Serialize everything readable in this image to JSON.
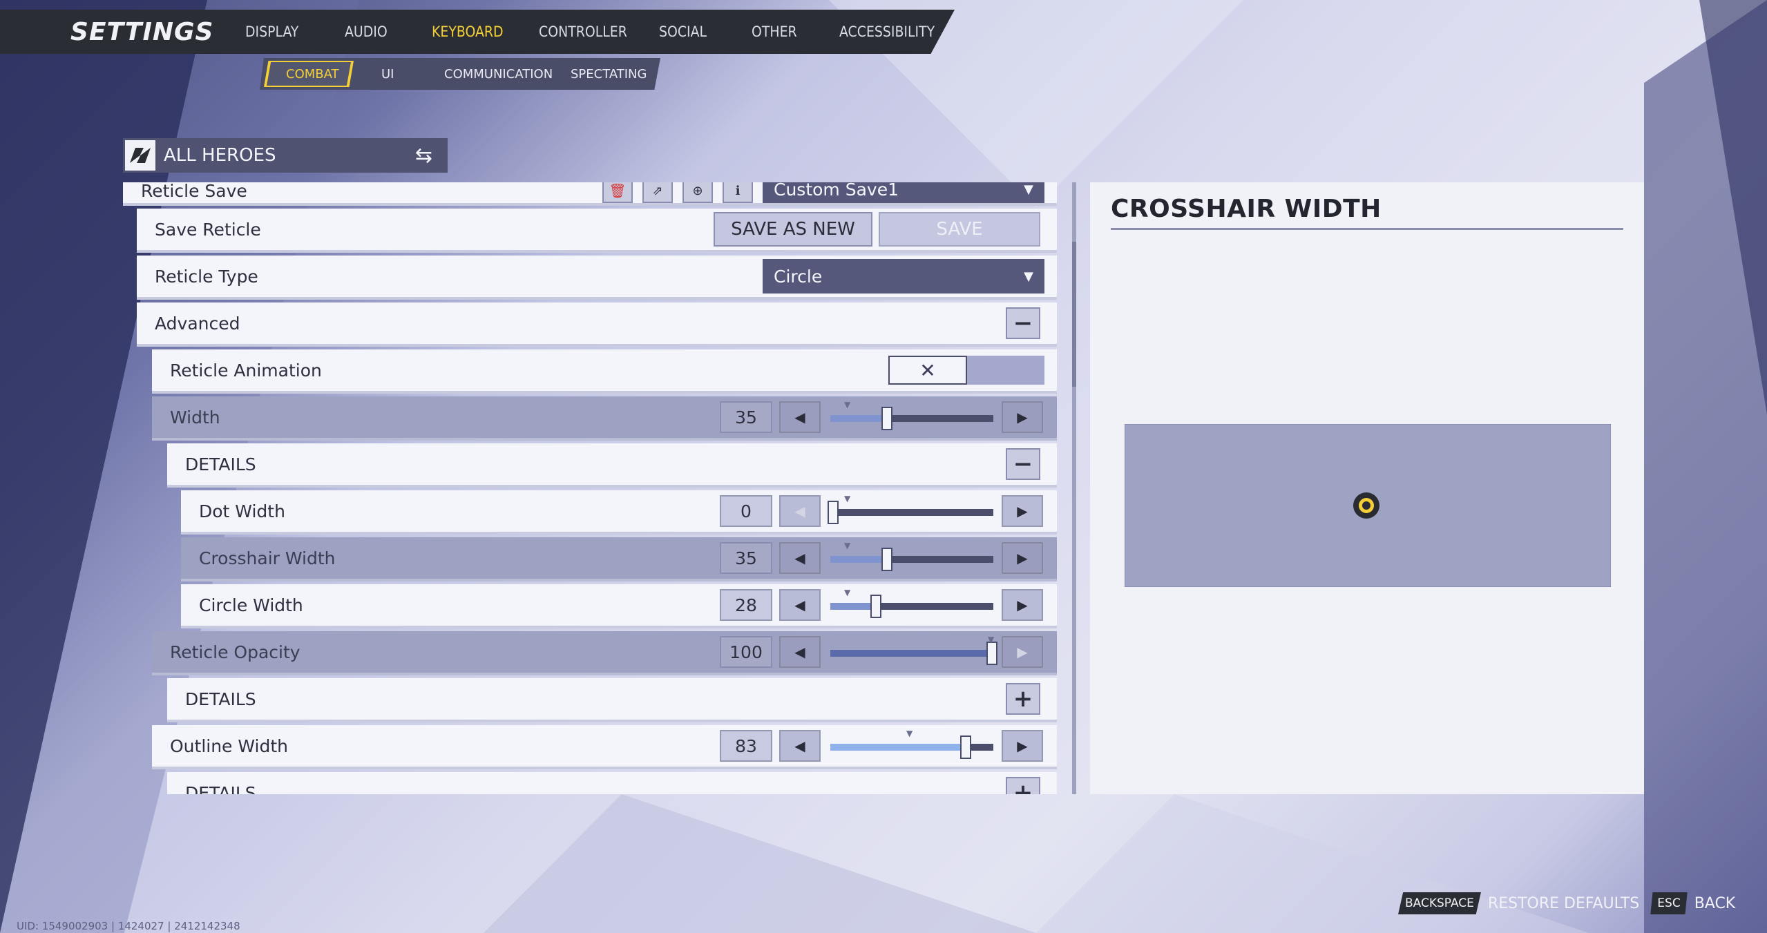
{
  "header": {
    "title": "SETTINGS",
    "tabs": [
      {
        "label": "DISPLAY",
        "active": false
      },
      {
        "label": "AUDIO",
        "active": false
      },
      {
        "label": "KEYBOARD",
        "active": true
      },
      {
        "label": "CONTROLLER",
        "active": false
      },
      {
        "label": "SOCIAL",
        "active": false
      },
      {
        "label": "OTHER",
        "active": false
      },
      {
        "label": "ACCESSIBILITY",
        "active": false
      }
    ],
    "subtabs": [
      {
        "label": "COMBAT",
        "active": true
      },
      {
        "label": "UI",
        "active": false
      },
      {
        "label": "COMMUNICATION",
        "active": false
      },
      {
        "label": "SPECTATING",
        "active": false
      }
    ]
  },
  "hero_selector": {
    "label": "ALL HEROES"
  },
  "settings": {
    "reticle_save": {
      "label": "Reticle Save",
      "dropdown_value": "Custom Save1"
    },
    "save_reticle": {
      "label": "Save Reticle",
      "save_as_new": "SAVE AS NEW",
      "save": "SAVE"
    },
    "reticle_type": {
      "label": "Reticle Type",
      "value": "Circle"
    },
    "advanced": {
      "label": "Advanced"
    },
    "reticle_animation": {
      "label": "Reticle Animation",
      "enabled": false
    },
    "width": {
      "label": "Width",
      "value": "35"
    },
    "width_details": {
      "label": "DETAILS"
    },
    "dot_width": {
      "label": "Dot Width",
      "value": "0"
    },
    "crosshair_width": {
      "label": "Crosshair Width",
      "value": "35"
    },
    "circle_width": {
      "label": "Circle Width",
      "value": "28"
    },
    "reticle_opacity": {
      "label": "Reticle Opacity",
      "value": "100"
    },
    "opacity_details": {
      "label": "DETAILS"
    },
    "outline_width": {
      "label": "Outline Width",
      "value": "83"
    },
    "outline_details": {
      "label": "DETAILS"
    }
  },
  "preview": {
    "title": "CROSSHAIR WIDTH"
  },
  "footer": {
    "restore_key": "BACKSPACE",
    "restore_label": "RESTORE DEFAULTS",
    "back_key": "ESC",
    "back_label": "BACK",
    "uid": "UID: 1549002903 | 1424027 | 2412142348"
  },
  "colors": {
    "accent": "#f4cf36",
    "dark_bar": "#2b2d35"
  }
}
